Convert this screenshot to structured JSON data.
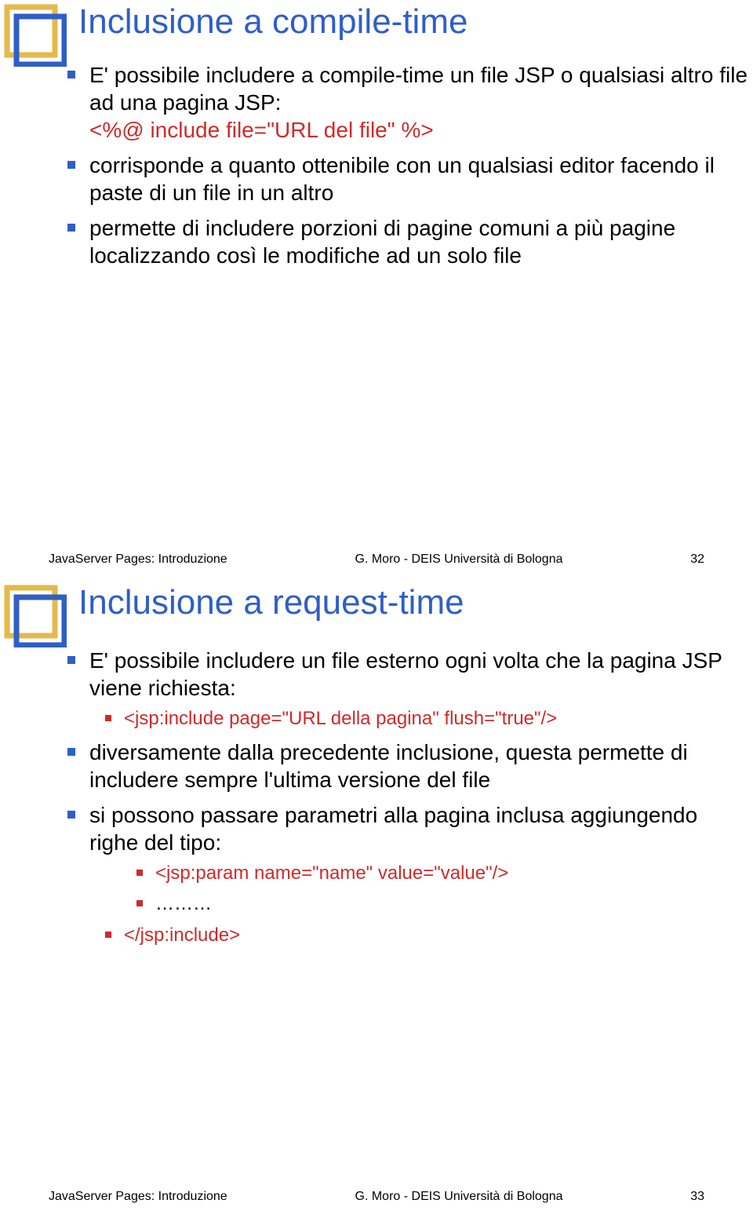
{
  "slide1": {
    "title": "Inclusione a compile-time",
    "bullets": [
      {
        "text": "E' possibile includere a compile-time un file JSP o qualsiasi altro file ad una pagina JSP:",
        "code": "<%@ include file=\"URL del file\" %>"
      },
      {
        "text": "corrisponde a quanto ottenibile con un qualsiasi editor facendo il paste di un file in un altro"
      },
      {
        "text": "permette di includere porzioni di pagine comuni a più pagine localizzando così le modifiche ad un solo file"
      }
    ],
    "footer": {
      "left": "JavaServer Pages: Introduzione",
      "center": "G. Moro - DEIS Università di Bologna",
      "page": "32"
    }
  },
  "slide2": {
    "title": "Inclusione a request-time",
    "bullets": [
      {
        "text": "E' possibile includere un file esterno ogni volta che la pagina JSP viene richiesta:",
        "sub": [
          {
            "code": "<jsp:include page=\"URL della pagina\" flush=\"true\"/>"
          }
        ]
      },
      {
        "text": "diversamente dalla precedente inclusione, questa permette di includere sempre l'ultima versione del file"
      },
      {
        "text": "si possono passare parametri alla pagina inclusa aggiungendo righe del tipo:",
        "sub": [
          {
            "code": "<jsp:param name=\"name\" value=\"value\"/>"
          },
          {
            "code": "………"
          },
          {
            "code": "</jsp:include>"
          }
        ]
      }
    ],
    "footer": {
      "left": "JavaServer Pages: Introduzione",
      "center": "G. Moro - DEIS Università di Bologna",
      "page": "33"
    }
  }
}
